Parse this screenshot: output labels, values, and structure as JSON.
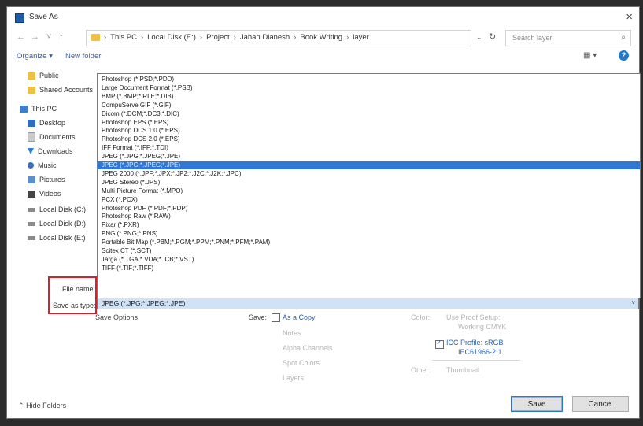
{
  "window": {
    "title": "Save As",
    "close": "×"
  },
  "nav": {
    "back": "←",
    "forward": "→",
    "up_arrow": "˅",
    "up": "↑",
    "dropdown": "⌄",
    "refresh": "↻",
    "search_placeholder": "Search layer",
    "search_icon": "⌕"
  },
  "breadcrumbs": [
    "This PC",
    "Local Disk (E:)",
    "Project",
    "Jahan Dianesh",
    "Book Writing",
    "layer"
  ],
  "breadcrumb_sep": "›",
  "toolbar": {
    "organize": "Organize ▾",
    "new_folder": "New folder",
    "view": "▦ ▾",
    "help": "?"
  },
  "sidebar": {
    "items": [
      {
        "label": "Public",
        "icon": "folder-icon"
      },
      {
        "label": "Shared Accounts",
        "icon": "folder-icon"
      },
      {
        "label": "This PC",
        "icon": "pc-icon"
      },
      {
        "label": "Desktop",
        "icon": "desktop-icon"
      },
      {
        "label": "Documents",
        "icon": "document-icon"
      },
      {
        "label": "Downloads",
        "icon": "download-icon"
      },
      {
        "label": "Music",
        "icon": "music-icon"
      },
      {
        "label": "Pictures",
        "icon": "pictures-icon"
      },
      {
        "label": "Videos",
        "icon": "video-icon"
      },
      {
        "label": "Local Disk (C:)",
        "icon": "disk-icon"
      },
      {
        "label": "Local Disk (D:)",
        "icon": "disk-icon"
      },
      {
        "label": "Local Disk (E:)",
        "icon": "disk-icon"
      }
    ]
  },
  "file_types": {
    "selected_index": 10,
    "options": [
      "Photoshop (*.PSD;*.PDD)",
      "Large Document Format (*.PSB)",
      "BMP (*.BMP;*.RLE;*.DIB)",
      "CompuServe GIF (*.GIF)",
      "Dicom (*.DCM;*.DC3;*.DIC)",
      "Photoshop EPS (*.EPS)",
      "Photoshop DCS 1.0 (*.EPS)",
      "Photoshop DCS 2.0 (*.EPS)",
      "IFF Format (*.IFF;*.TDI)",
      "JPEG (*.JPG;*.JPEG;*.JPE)",
      "JPEG (*.JPG;*.JPEG;*.JPE)",
      "JPEG 2000 (*.JPF;*.JPX;*.JP2;*.J2C;*.J2K;*.JPC)",
      "JPEG Stereo (*.JPS)",
      "Multi-Picture Format (*.MPO)",
      "PCX (*.PCX)",
      "Photoshop PDF (*.PDF;*.PDP)",
      "Photoshop Raw (*.RAW)",
      "Pixar (*.PXR)",
      "PNG (*.PNG;*.PNS)",
      "Portable Bit Map (*.PBM;*.PGM;*.PPM;*.PNM;*.PFM;*.PAM)",
      "Scitex CT (*.SCT)",
      "Targa (*.TGA;*.VDA;*.ICB;*.VST)",
      "TIFF (*.TIF;*.TIFF)"
    ]
  },
  "form": {
    "file_name_label": "File name:",
    "save_as_type_label": "Save as type:",
    "save_as_type_value": "JPEG (*.JPG;*.JPEG;*.JPE)",
    "chevron": "˅"
  },
  "save_options": {
    "title": "Save Options",
    "save_label": "Save:",
    "as_a_copy": "As a Copy",
    "notes": "Notes",
    "alpha_channels": "Alpha Channels",
    "spot_colors": "Spot Colors",
    "layers": "Layers",
    "color_label": "Color:",
    "use_proof_setup": "Use Proof Setup:",
    "working_cmyk": "Working CMYK",
    "icc_profile": "ICC Profile: sRGB",
    "icc_profile_line2": "IEC61966-2.1",
    "other_label": "Other:",
    "thumbnail": "Thumbnail"
  },
  "footer": {
    "hide_folders": "Hide Folders",
    "hide_folders_icon": "⌃",
    "save": "Save",
    "cancel": "Cancel"
  }
}
